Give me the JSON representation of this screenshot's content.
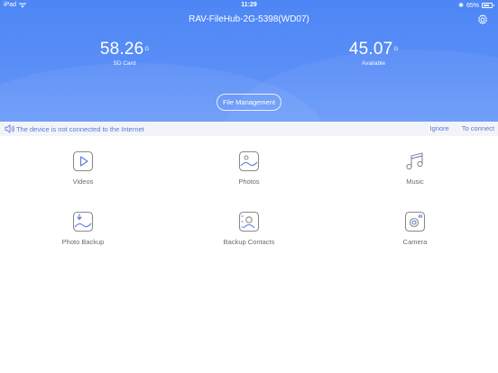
{
  "status": {
    "device": "iPad",
    "time": "11:29",
    "battery": "65%"
  },
  "header": {
    "title": "RAV-FileHub-2G-5398(WD07)"
  },
  "storage": {
    "sd_card": {
      "value": "58.26",
      "unit": "G",
      "label": "SD Card"
    },
    "available": {
      "value": "45.07",
      "unit": "G",
      "label": "Available"
    }
  },
  "file_management": {
    "label": "File Management"
  },
  "notice": {
    "text": "The device is not connected to the Internet",
    "ignore": "Ignore",
    "connect": "To connect"
  },
  "tiles": [
    {
      "label": "Videos",
      "icon": "play-video-icon"
    },
    {
      "label": "Photos",
      "icon": "photo-icon"
    },
    {
      "label": "Music",
      "icon": "music-note-icon"
    },
    {
      "label": "Photo Backup",
      "icon": "photo-backup-icon"
    },
    {
      "label": "Backup Contacts",
      "icon": "contact-backup-icon"
    },
    {
      "label": "Camera",
      "icon": "camera-icon"
    }
  ],
  "colors": {
    "accent": "#4d86f5",
    "link": "#5a78d8",
    "icon_stroke": "#8a8a8a",
    "notice_bg": "#f2f4f8"
  }
}
